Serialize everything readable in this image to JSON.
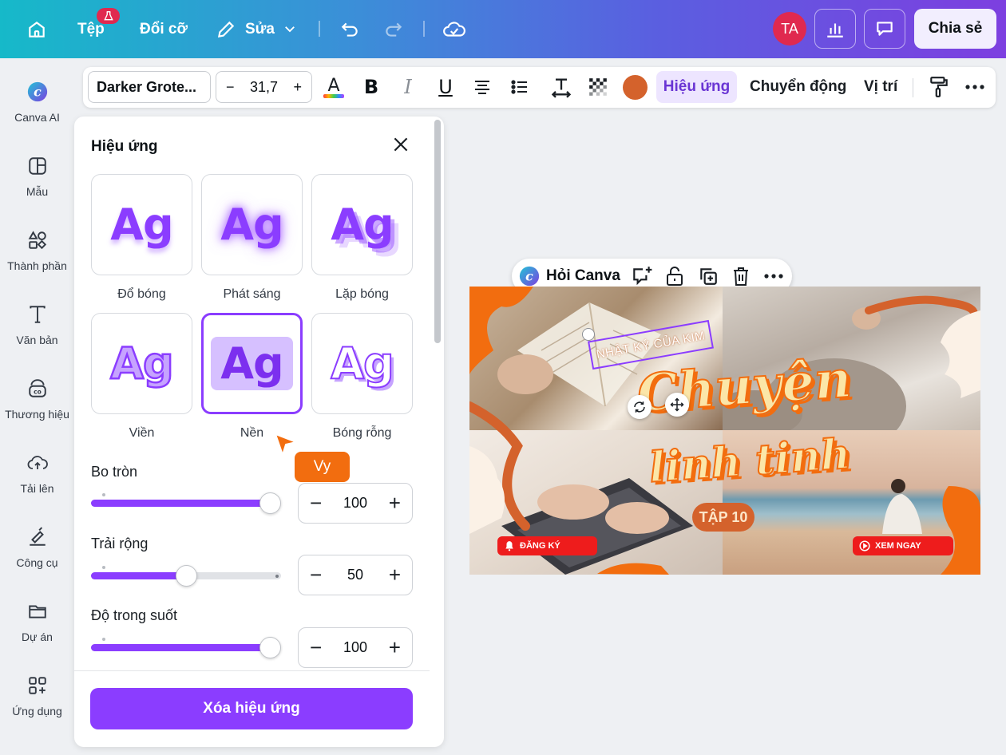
{
  "topbar": {
    "file_label": "Tệp",
    "resize_label": "Đổi cỡ",
    "edit_label": "Sửa",
    "avatar_initials": "TA",
    "share_label": "Chia sẻ"
  },
  "sidebar": {
    "items": [
      {
        "label": "Canva AI",
        "icon": "canva-ai-icon"
      },
      {
        "label": "Mẫu",
        "icon": "templates-icon"
      },
      {
        "label": "Thành phần",
        "icon": "elements-icon"
      },
      {
        "label": "Văn bản",
        "icon": "text-icon"
      },
      {
        "label": "Thương hiệu",
        "icon": "brand-icon"
      },
      {
        "label": "Tải lên",
        "icon": "upload-icon"
      },
      {
        "label": "Công cụ",
        "icon": "tools-icon"
      },
      {
        "label": "Dự án",
        "icon": "projects-icon"
      },
      {
        "label": "Ứng dụng",
        "icon": "apps-icon"
      }
    ]
  },
  "format_bar": {
    "font_name": "Darker Grote...",
    "font_size": "31,7",
    "minus": "−",
    "plus": "+",
    "text_color_letter": "A",
    "bold": "B",
    "italic": "I",
    "underline": "U",
    "effects_label": "Hiệu ứng",
    "animate_label": "Chuyển động",
    "position_label": "Vị trí",
    "selected_color": "#d4622c"
  },
  "effects_panel": {
    "title": "Hiệu ứng",
    "sample_text": "Ag",
    "effects": [
      {
        "label": "Đổ bóng",
        "style": "shadow",
        "selected": false
      },
      {
        "label": "Phát sáng",
        "style": "glow",
        "selected": false
      },
      {
        "label": "Lặp bóng",
        "style": "echo",
        "selected": false
      },
      {
        "label": "Viền",
        "style": "outline",
        "selected": false
      },
      {
        "label": "Nền",
        "style": "bg",
        "selected": true
      },
      {
        "label": "Bóng rỗng",
        "style": "hollow",
        "selected": false
      }
    ],
    "sliders": [
      {
        "label": "Bo tròn",
        "value": "100",
        "fraction": 1.0
      },
      {
        "label": "Trải rộng",
        "value": "50",
        "fraction": 0.5
      },
      {
        "label": "Độ trong suốt",
        "value": "100",
        "fraction": 1.0
      }
    ],
    "clear_label": "Xóa hiệu ứng"
  },
  "collaborator": {
    "name": "Vy",
    "color": "#f26d0f"
  },
  "context_menu": {
    "ask_label": "Hỏi Canva"
  },
  "design": {
    "kicker": "NHẬT KÝ CỦA KIM",
    "title_line1": "Chuyện",
    "title_line2": "linh tinh",
    "episode": "TẬP 10",
    "subscribe_label": "ĐĂNG KÝ",
    "watch_label": "XEM NGAY"
  },
  "colors": {
    "accent": "#8b3dff",
    "brand_orange": "#f26d0f"
  }
}
